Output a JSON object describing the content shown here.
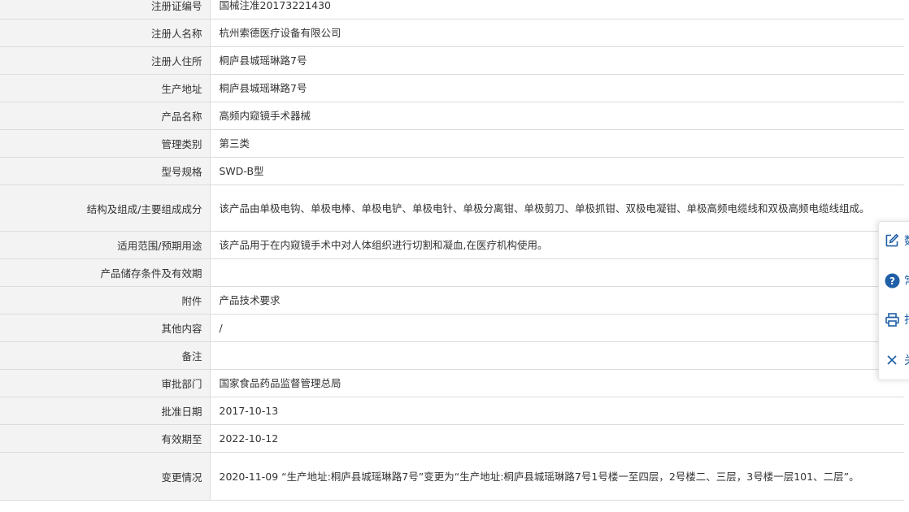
{
  "rows": [
    {
      "label": "注册证编号",
      "value": "国械注准20173221430"
    },
    {
      "label": "注册人名称",
      "value": "杭州索德医疗设备有限公司"
    },
    {
      "label": "注册人住所",
      "value": "桐庐县城瑶琳路7号"
    },
    {
      "label": "生产地址",
      "value": "桐庐县城瑶琳路7号"
    },
    {
      "label": "产品名称",
      "value": "高频内窥镜手术器械"
    },
    {
      "label": "管理类别",
      "value": "第三类"
    },
    {
      "label": "型号规格",
      "value": "SWD-B型"
    },
    {
      "label": "结构及组成/主要组成成分",
      "value": "该产品由单极电钩、单极电棒、单极电铲、单极电针、单极分离钳、单极剪刀、单极抓钳、双极电凝钳、单极高频电缆线和双极高频电缆线组成。"
    },
    {
      "label": "适用范围/预期用途",
      "value": "该产品用于在内窥镜手术中对人体组织进行切割和凝血,在医疗机构使用。"
    },
    {
      "label": "产品储存条件及有效期",
      "value": ""
    },
    {
      "label": "附件",
      "value": "产品技术要求"
    },
    {
      "label": "其他内容",
      "value": "/"
    },
    {
      "label": "备注",
      "value": ""
    },
    {
      "label": "审批部门",
      "value": "国家食品药品监督管理总局"
    },
    {
      "label": "批准日期",
      "value": "2017-10-13"
    },
    {
      "label": "有效期至",
      "value": "2022-10-12"
    },
    {
      "label": "变更情况",
      "value": "2020-11-09 “生产地址:桐庐县城瑶琳路7号”变更为“生产地址:桐庐县城瑶琳路7号1号楼一至四层，2号楼二、三层，3号楼一层101、二层”。"
    }
  ],
  "side_panel": {
    "items": [
      {
        "icon": "edit-icon",
        "label": "数"
      },
      {
        "icon": "help-icon",
        "label": "常"
      },
      {
        "icon": "print-icon",
        "label": "打"
      },
      {
        "icon": "close-icon",
        "label": "关"
      }
    ],
    "accent_color": "#1f5fa8"
  }
}
